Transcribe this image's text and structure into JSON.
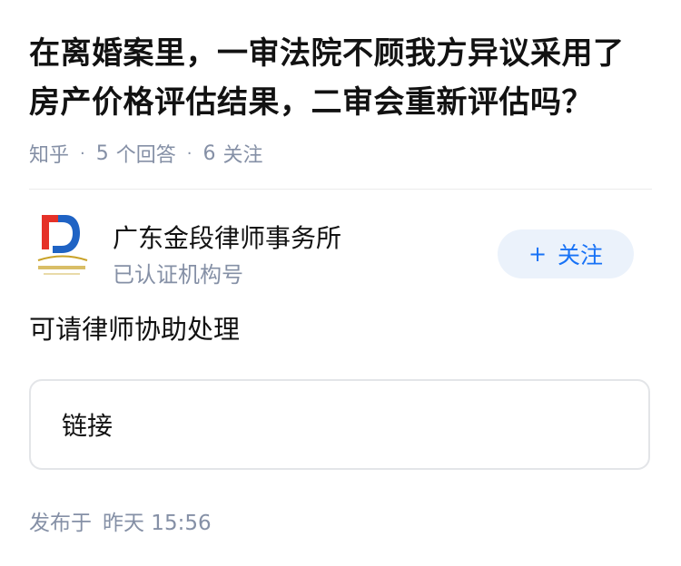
{
  "question": {
    "title": "在离婚案里，一审法院不顾我方异议采用了房产价格评估结果，二审会重新评估吗？",
    "source": "知乎",
    "answer_count": "5",
    "answer_label": "个回答",
    "follower_count": "6",
    "follower_label": "关注"
  },
  "author": {
    "name": "广东金段律师事务所",
    "badge": "已认证机构号",
    "avatar_icon": "law-firm-logo-icon",
    "follow_label": "关注",
    "follow_icon": "+"
  },
  "answer": {
    "text": "可请律师协助处理",
    "link_label": "链接"
  },
  "footer": {
    "publish_label": "发布于",
    "publish_time": "昨天 15:56"
  },
  "colors": {
    "text_primary": "#121212",
    "text_secondary": "#8590a6",
    "accent": "#1772f6",
    "follow_bg": "#ebf2fb",
    "logo_red": "#e53128",
    "logo_blue": "#1f63c4",
    "logo_gold": "#c9a227"
  }
}
